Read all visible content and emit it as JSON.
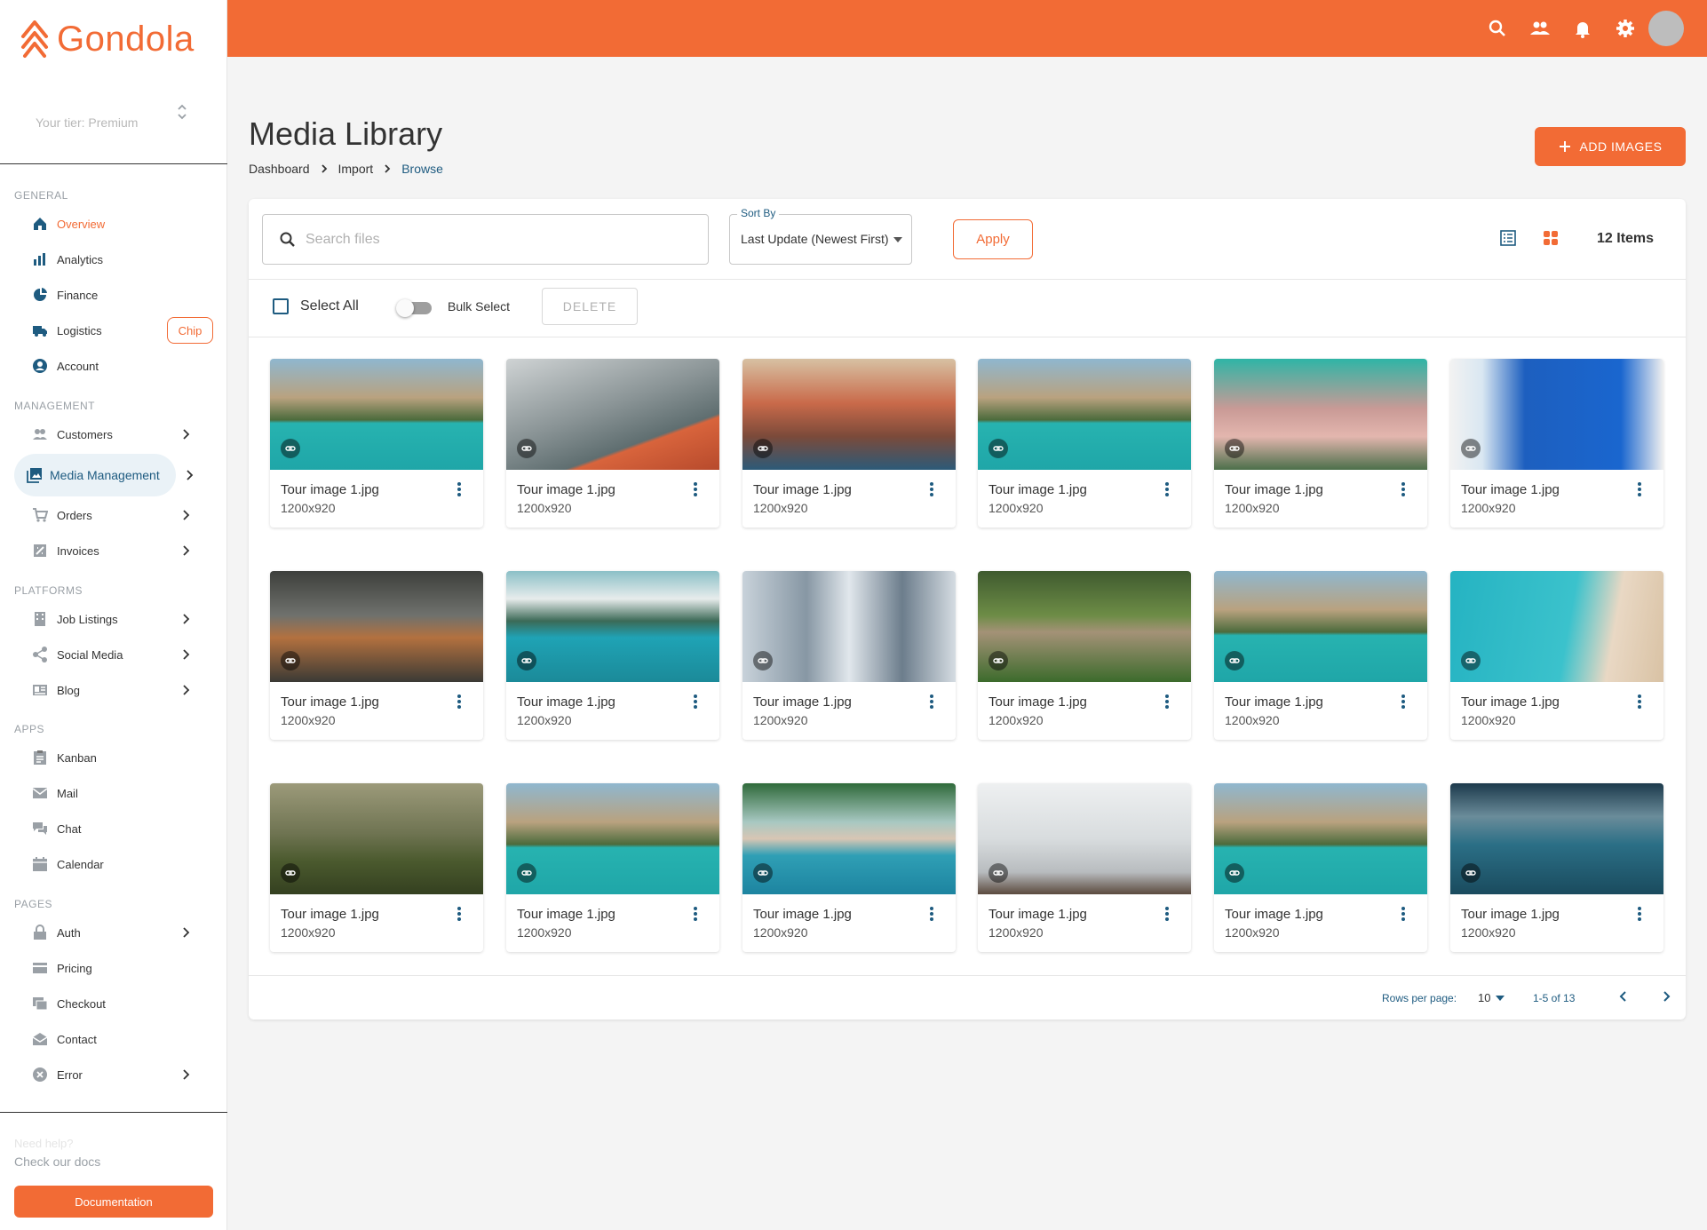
{
  "app": {
    "name": "Gondola",
    "tier": "Your tier: Premium"
  },
  "sidebar": {
    "sections": {
      "general": "GENERAL",
      "management": "MANAGEMENT",
      "platforms": "PLATFORMS",
      "apps": "APPS",
      "pages": "PAGES"
    },
    "items": {
      "overview": "Overview",
      "analytics": "Analytics",
      "finance": "Finance",
      "logistics": "Logistics",
      "account": "Account",
      "customers": "Customers",
      "media": "Media Management",
      "orders": "Orders",
      "invoices": "Invoices",
      "jobs": "Job  Listings",
      "social": "Social  Media",
      "blog": "Blog",
      "kanban": "Kanban",
      "mail": "Mail",
      "chat": "Chat",
      "calendar": "Calendar",
      "auth": "Auth",
      "pricing": "Pricing",
      "checkout": "Checkout",
      "contact": "Contact",
      "error": "Error"
    },
    "chip": "Chip",
    "help_title": "Need help?",
    "help_link": "Check our docs",
    "doc_button": "Documentation"
  },
  "header": {
    "title": "Media Library",
    "breadcrumb": [
      "Dashboard",
      "Import",
      "Browse"
    ],
    "add_button": "ADD IMAGES"
  },
  "toolbar": {
    "search_placeholder": "Search files",
    "sort_label": "Sort By",
    "sort_value": "Last Update (Newest First)",
    "apply": "Apply",
    "items_count": "12 Items",
    "select_all": "Select All",
    "bulk_select": "Bulk Select",
    "delete": "DELETE"
  },
  "cards": [
    {
      "name": "Tour image 1.jpg",
      "dims": "1200x920"
    },
    {
      "name": "Tour image 1.jpg",
      "dims": "1200x920"
    },
    {
      "name": "Tour image 1.jpg",
      "dims": "1200x920"
    },
    {
      "name": "Tour image 1.jpg",
      "dims": "1200x920"
    },
    {
      "name": "Tour image 1.jpg",
      "dims": "1200x920"
    },
    {
      "name": "Tour image 1.jpg",
      "dims": "1200x920"
    },
    {
      "name": "Tour image 1.jpg",
      "dims": "1200x920"
    },
    {
      "name": "Tour image 1.jpg",
      "dims": "1200x920"
    },
    {
      "name": "Tour image 1.jpg",
      "dims": "1200x920"
    },
    {
      "name": "Tour image 1.jpg",
      "dims": "1200x920"
    },
    {
      "name": "Tour image 1.jpg",
      "dims": "1200x920"
    },
    {
      "name": "Tour image 1.jpg",
      "dims": "1200x920"
    },
    {
      "name": "Tour image 1.jpg",
      "dims": "1200x920"
    },
    {
      "name": "Tour image 1.jpg",
      "dims": "1200x920"
    },
    {
      "name": "Tour image 1.jpg",
      "dims": "1200x920"
    },
    {
      "name": "Tour image 1.jpg",
      "dims": "1200x920"
    },
    {
      "name": "Tour image 1.jpg",
      "dims": "1200x920"
    },
    {
      "name": "Tour image 1.jpg",
      "dims": "1200x920"
    }
  ],
  "pagination": {
    "rows_label": "Rows per page:",
    "rows_value": "10",
    "range": "1-5 of 13"
  },
  "colors": {
    "brand": "#f26b35",
    "accent": "#1e5b80"
  }
}
